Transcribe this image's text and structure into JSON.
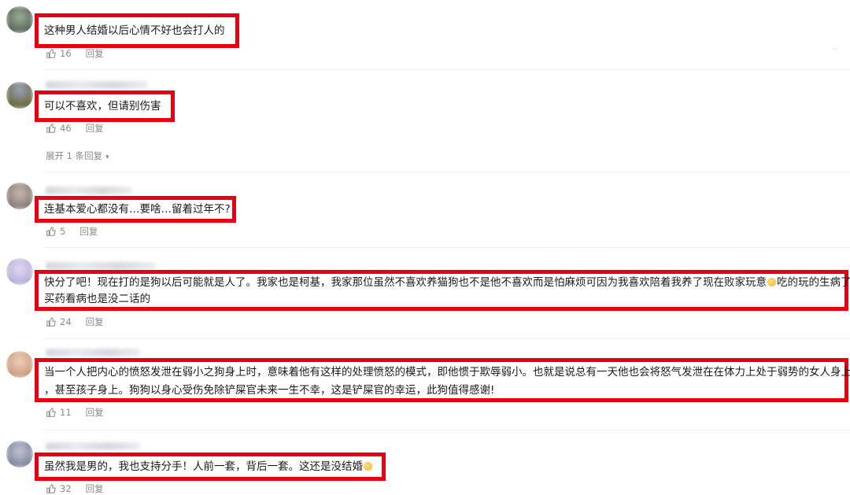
{
  "comments": [
    {
      "text": "这种男人结婚以后心情不好也会打人的",
      "likes": "16",
      "reply": "回复",
      "avatar_color": "#4a5a4a"
    },
    {
      "text": "可以不喜欢，但请别伤害",
      "likes": "46",
      "reply": "回复",
      "avatar_color": "#6b6a3a"
    },
    {
      "text": "连基本爱心都没有…要啥…留着过年不?",
      "likes": "5",
      "reply": "回复",
      "avatar_color": "#7a6e66"
    },
    {
      "line1": "快分了吧！现在打的是狗以后可能就是人了。我家也是柯基，我家那位虽然不喜欢养猫狗也不是他不喜欢而是怕麻烦可因为我喜欢陪着我养了现在败家玩意",
      "line1b": "吃的玩的生病了",
      "line2": "买药看病也是没二话的",
      "likes": "24",
      "reply": "回复",
      "avatar_color": "#b9b0d8"
    },
    {
      "line1": "当一个人把内心的愤怒发泄在弱小之狗身上时，意味着他有这样的处理愤怒的模式，即他惯于欺辱弱小。也就是说总有一天他也会将怒气发泄在在体力上处于弱势的女人身上",
      "line2": "，甚至孩子身上。狗狗以身心受伤免除铲屎官未来一生不幸，这是铲屎官的幸运，此狗值得感谢!",
      "likes": "11",
      "reply": "回复",
      "avatar_color": "#d9b49a"
    },
    {
      "text": "虽然我是男的，我也支持分手！人前一套，背后一套。这还是没结婚",
      "likes": "32",
      "reply": "回复",
      "avatar_color": "#8a8fa6"
    }
  ],
  "expand_replies": "展开 1 条回复",
  "colors": {
    "highlight": "#e60012",
    "meta": "#8a8a8a"
  }
}
